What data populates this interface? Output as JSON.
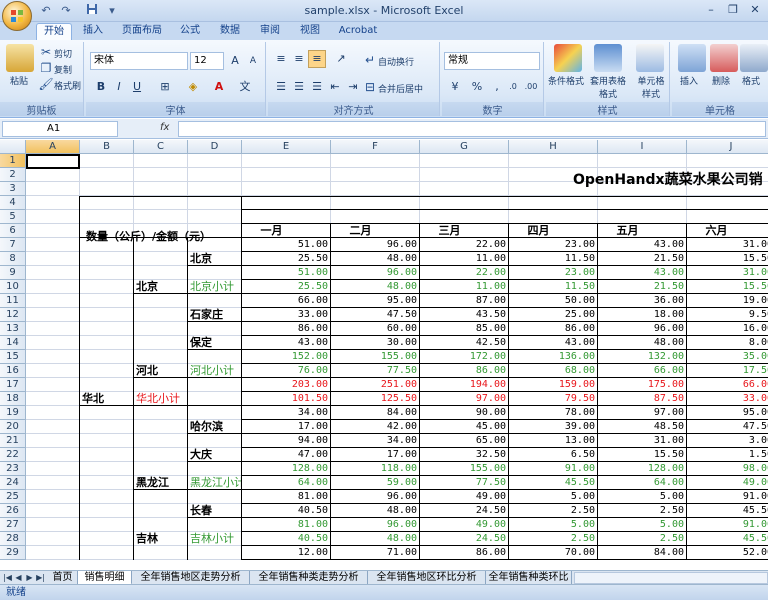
{
  "window": {
    "title": "sample.xlsx - Microsoft Excel"
  },
  "ribbon_tabs": [
    "开始",
    "插入",
    "页面布局",
    "公式",
    "数据",
    "审阅",
    "视图",
    "Acrobat"
  ],
  "ribbon": {
    "clipboard": {
      "label": "剪贴板",
      "paste": "粘贴",
      "cut": "剪切",
      "copy": "复制",
      "format_painter": "格式刷"
    },
    "font": {
      "label": "字体",
      "name": "宋体",
      "size": "12"
    },
    "alignment": {
      "label": "对齐方式",
      "wrap": "自动换行",
      "merge": "合并后居中"
    },
    "number": {
      "label": "数字",
      "format": "常规"
    },
    "styles": {
      "label": "样式",
      "conditional": "条件格式",
      "table": "套用表格格式",
      "cell": "单元格样式"
    },
    "cells": {
      "label": "单元格",
      "insert": "插入",
      "delete": "删除",
      "format": "格式"
    }
  },
  "formula_bar": {
    "name_box": "A1",
    "fx": "fx",
    "content": ""
  },
  "columns": [
    "A",
    "B",
    "C",
    "D",
    "E",
    "F",
    "G",
    "H",
    "I",
    "J"
  ],
  "rows": [
    "1",
    "2",
    "3",
    "4",
    "5",
    "6",
    "7",
    "8",
    "9",
    "10",
    "11",
    "12",
    "13",
    "14",
    "15",
    "16",
    "17",
    "18",
    "19",
    "20",
    "21",
    "22",
    "23",
    "24",
    "25",
    "26",
    "27",
    "28",
    "29"
  ],
  "sheet": {
    "title": "OpenHandx蔬菜水果公司销",
    "header_label": "数量（公斤）/金额（元）",
    "months": [
      "一月",
      "二月",
      "三月",
      "四月",
      "五月",
      "六月"
    ],
    "labels": {
      "huabei": "华北",
      "huabei_subtotal": "华北小计",
      "beijing_region": "北京",
      "beijing_city": "北京",
      "beijing_subtotal": "北京小计",
      "hebei": "河北",
      "shijiazhuang": "石家庄",
      "baoding": "保定",
      "hebei_subtotal": "河北小计",
      "heilongjiang": "黑龙江",
      "haerbin": "哈尔滨",
      "daqing": "大庆",
      "hlj_subtotal": "黑龙江小计",
      "jilin": "吉林",
      "changchun": "长春",
      "jilin_subtotal": "吉林小计"
    },
    "data_rows": [
      {
        "row": 7,
        "style": "normal",
        "values": [
          "51.00",
          "96.00",
          "22.00",
          "23.00",
          "43.00",
          "31.00"
        ]
      },
      {
        "row": 8,
        "style": "normal",
        "values": [
          "25.50",
          "48.00",
          "11.00",
          "11.50",
          "21.50",
          "15.50"
        ]
      },
      {
        "row": 9,
        "style": "green",
        "values": [
          "51.00",
          "96.00",
          "22.00",
          "23.00",
          "43.00",
          "31.00"
        ]
      },
      {
        "row": 10,
        "style": "green",
        "values": [
          "25.50",
          "48.00",
          "11.00",
          "11.50",
          "21.50",
          "15.50"
        ]
      },
      {
        "row": 11,
        "style": "normal",
        "values": [
          "66.00",
          "95.00",
          "87.00",
          "50.00",
          "36.00",
          "19.00"
        ]
      },
      {
        "row": 12,
        "style": "normal",
        "values": [
          "33.00",
          "47.50",
          "43.50",
          "25.00",
          "18.00",
          "9.50"
        ]
      },
      {
        "row": 13,
        "style": "normal",
        "values": [
          "86.00",
          "60.00",
          "85.00",
          "86.00",
          "96.00",
          "16.00"
        ]
      },
      {
        "row": 14,
        "style": "normal",
        "values": [
          "43.00",
          "30.00",
          "42.50",
          "43.00",
          "48.00",
          "8.00"
        ]
      },
      {
        "row": 15,
        "style": "green",
        "values": [
          "152.00",
          "155.00",
          "172.00",
          "136.00",
          "132.00",
          "35.00"
        ]
      },
      {
        "row": 16,
        "style": "green",
        "values": [
          "76.00",
          "77.50",
          "86.00",
          "68.00",
          "66.00",
          "17.50"
        ]
      },
      {
        "row": 17,
        "style": "red",
        "values": [
          "203.00",
          "251.00",
          "194.00",
          "159.00",
          "175.00",
          "66.00"
        ]
      },
      {
        "row": 18,
        "style": "red",
        "values": [
          "101.50",
          "125.50",
          "97.00",
          "79.50",
          "87.50",
          "33.00"
        ]
      },
      {
        "row": 19,
        "style": "normal",
        "values": [
          "34.00",
          "84.00",
          "90.00",
          "78.00",
          "97.00",
          "95.00"
        ]
      },
      {
        "row": 20,
        "style": "normal",
        "values": [
          "17.00",
          "42.00",
          "45.00",
          "39.00",
          "48.50",
          "47.50"
        ]
      },
      {
        "row": 21,
        "style": "normal",
        "values": [
          "94.00",
          "34.00",
          "65.00",
          "13.00",
          "31.00",
          "3.00"
        ]
      },
      {
        "row": 22,
        "style": "normal",
        "values": [
          "47.00",
          "17.00",
          "32.50",
          "6.50",
          "15.50",
          "1.50"
        ]
      },
      {
        "row": 23,
        "style": "green",
        "values": [
          "128.00",
          "118.00",
          "155.00",
          "91.00",
          "128.00",
          "98.00"
        ]
      },
      {
        "row": 24,
        "style": "green",
        "values": [
          "64.00",
          "59.00",
          "77.50",
          "45.50",
          "64.00",
          "49.00"
        ]
      },
      {
        "row": 25,
        "style": "normal",
        "values": [
          "81.00",
          "96.00",
          "49.00",
          "5.00",
          "5.00",
          "91.00"
        ]
      },
      {
        "row": 26,
        "style": "normal",
        "values": [
          "40.50",
          "48.00",
          "24.50",
          "2.50",
          "2.50",
          "45.50"
        ]
      },
      {
        "row": 27,
        "style": "green",
        "values": [
          "81.00",
          "96.00",
          "49.00",
          "5.00",
          "5.00",
          "91.00"
        ]
      },
      {
        "row": 28,
        "style": "green",
        "values": [
          "40.50",
          "48.00",
          "24.50",
          "2.50",
          "2.50",
          "45.50"
        ]
      },
      {
        "row": 29,
        "style": "normal",
        "values": [
          "12.00",
          "71.00",
          "86.00",
          "70.00",
          "84.00",
          "52.00"
        ]
      }
    ]
  },
  "sheet_tabs": [
    "首页",
    "销售明细",
    "全年销售地区走势分析",
    "全年销售种类走势分析",
    "全年销售地区环比分析",
    "全年销售种类环比"
  ],
  "active_sheet": "销售明细",
  "status": "就绪",
  "colors": {
    "green": "#339933",
    "red": "#e8161b",
    "accent": "#15428b"
  }
}
